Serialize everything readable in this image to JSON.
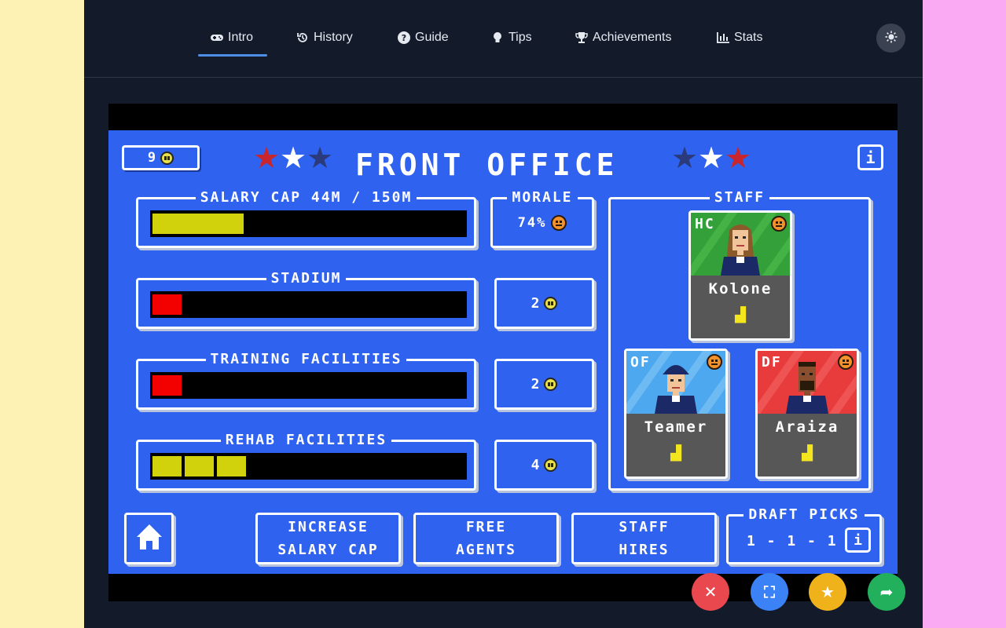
{
  "nav": {
    "items": [
      {
        "label": "Intro",
        "icon": "gamepad-icon",
        "active": true
      },
      {
        "label": "History",
        "icon": "history-icon"
      },
      {
        "label": "Guide",
        "icon": "question-circle-icon"
      },
      {
        "label": "Tips",
        "icon": "lightbulb-icon"
      },
      {
        "label": "Achievements",
        "icon": "trophy-icon"
      },
      {
        "label": "Stats",
        "icon": "bar-chart-icon"
      }
    ],
    "theme_icon": "sun-icon"
  },
  "game": {
    "coins": "9",
    "title": "FRONT OFFICE",
    "info_label": "i",
    "stars_left": [
      "#c8262c",
      "#ffffff",
      "#2a3a7a"
    ],
    "stars_right": [
      "#2a3a7a",
      "#ffffff",
      "#c8262c"
    ],
    "salary": {
      "label": "SALARY CAP 44M / 150M",
      "fill_fraction": 0.29,
      "color": "#d2d20c"
    },
    "morale": {
      "label": "MORALE",
      "value": "74%"
    },
    "stadium": {
      "label": "STADIUM",
      "level": 1,
      "cost": "2",
      "color": "#f30000"
    },
    "training": {
      "label": "TRAINING FACILITIES",
      "level": 1,
      "cost": "2",
      "color": "#f30000"
    },
    "rehab": {
      "label": "REHAB FACILITIES",
      "level": 3,
      "cost": "4",
      "color": "#d2d20c"
    },
    "staff": {
      "label": "STAFF",
      "members": [
        {
          "role": "HC",
          "name": "Kolone",
          "rating": "▟"
        },
        {
          "role": "OF",
          "name": "Teamer",
          "rating": "▟"
        },
        {
          "role": "DF",
          "name": "Araiza",
          "rating": "▟"
        }
      ]
    },
    "buttons": {
      "salary": [
        "INCREASE",
        "SALARY CAP"
      ],
      "free_agents": [
        "FREE",
        "AGENTS"
      ],
      "staff_hires": [
        "STAFF",
        "HIRES"
      ]
    },
    "draft": {
      "label": "DRAFT PICKS",
      "picks": "1 - 1 - 1"
    }
  },
  "fabs": [
    {
      "icon": "close-icon",
      "color": "#e8484e",
      "glyph": "✕"
    },
    {
      "icon": "fullscreen-icon",
      "color": "#3b82f6",
      "glyph": "⛶"
    },
    {
      "icon": "star-icon",
      "color": "#f0b21b",
      "glyph": "★"
    },
    {
      "icon": "share-icon",
      "color": "#22b05c",
      "glyph": "➦"
    }
  ]
}
